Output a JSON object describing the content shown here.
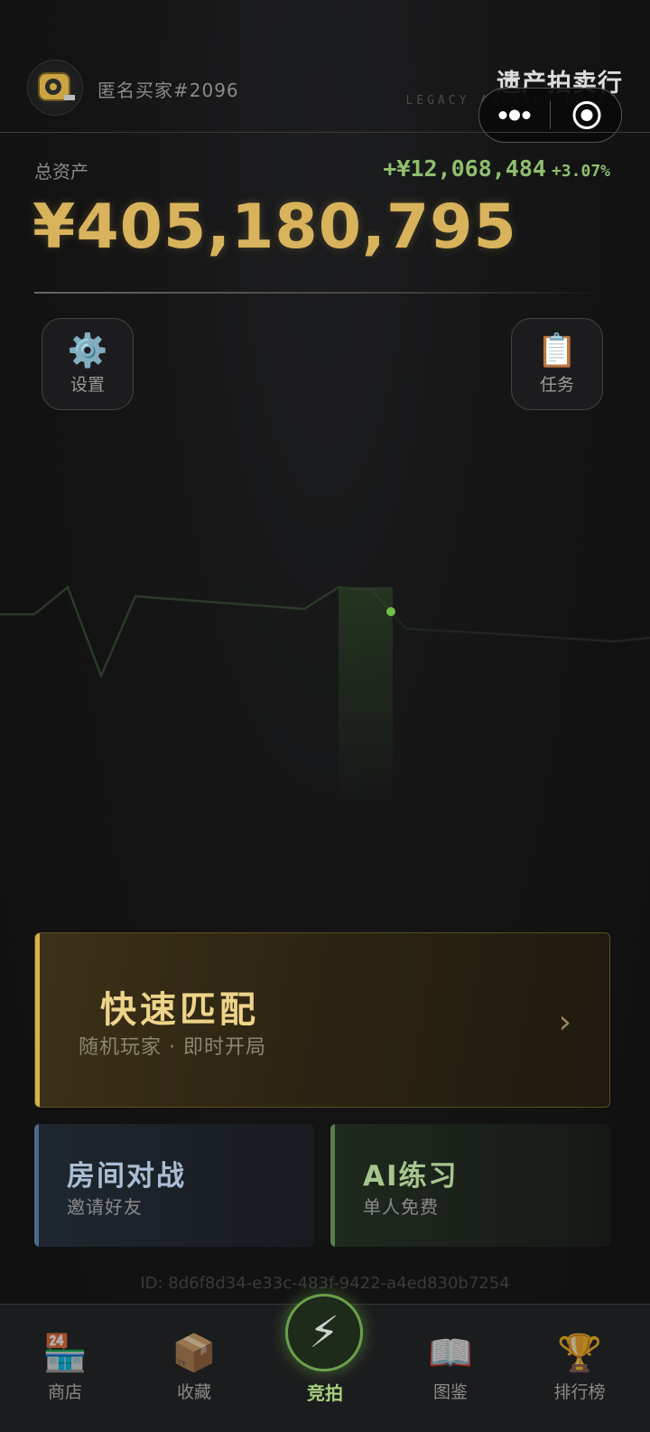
{
  "header": {
    "username": "匿名买家#2096",
    "app_title": "遗产拍卖行",
    "app_subtitle": "LEGACY AUCTION HOUSE"
  },
  "assets": {
    "label": "总资产",
    "value": "¥405,180,795",
    "change": "+¥12,068,484",
    "change_pct": "+3.07%"
  },
  "quick_actions": {
    "settings": {
      "label": "设置",
      "icon": "⚙️"
    },
    "tasks": {
      "label": "任务",
      "icon": "📋"
    }
  },
  "modes": {
    "quick_match": {
      "title": "快速匹配",
      "subtitle": "随机玩家 · 即时开局",
      "chevron": "›"
    },
    "room_battle": {
      "title": "房间对战",
      "subtitle": "邀请好友"
    },
    "ai_practice": {
      "title": "AI练习",
      "subtitle": "单人免费"
    }
  },
  "user_id": "ID: 8d6f8d34-e33c-483f-9422-a4ed830b7254",
  "nav": {
    "shop": {
      "label": "商店",
      "icon": "🏪"
    },
    "collection": {
      "label": "收藏",
      "icon": "📦"
    },
    "auction": {
      "label": "竞拍",
      "icon": "⚡"
    },
    "encyclopedia": {
      "label": "图鉴",
      "icon": "📖"
    },
    "leaderboard": {
      "label": "排行榜",
      "icon": "🏆"
    }
  },
  "colors": {
    "gold": "#d9b35c",
    "positive_green": "#8fbf6e",
    "room_blue": "#4b6b8a",
    "ai_green": "#5a7d48"
  }
}
